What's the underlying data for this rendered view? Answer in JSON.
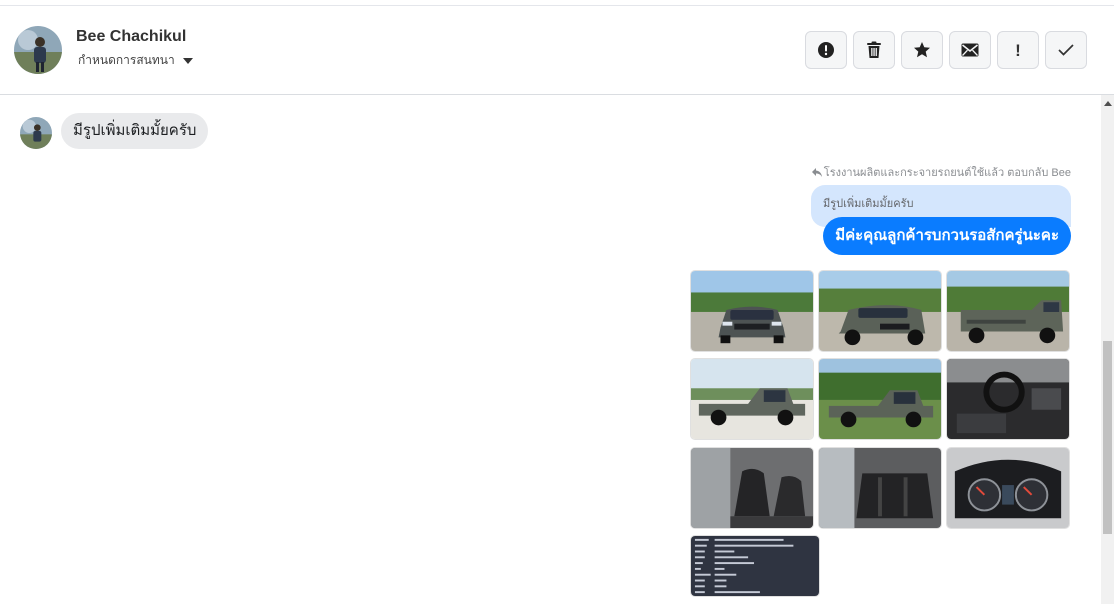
{
  "header": {
    "contact_name": "Bee Chachikul",
    "assign_label": "กำหนดการสนทนา"
  },
  "actions": [
    {
      "name": "alert-circle-icon",
      "label": ""
    },
    {
      "name": "trash-icon",
      "label": ""
    },
    {
      "name": "star-icon",
      "label": ""
    },
    {
      "name": "mail-icon",
      "label": ""
    },
    {
      "name": "exclamation-icon",
      "label": "!"
    },
    {
      "name": "check-icon",
      "label": ""
    }
  ],
  "messages": {
    "incoming_text": "มีรูปเพิ่มเติมมั้ยครับ",
    "reply_note": "โรงงานผลิตและกระจายรถยนต์ใช้แล้ว ตอบกลับ Bee",
    "quoted_text": "มีรูปเพิ่มเติมมั้ยครับ",
    "outgoing_text": "มีค่ะคุณลูกค้ารบกวนรอสักครู่นะคะ"
  },
  "photos": [
    {
      "name": "car-front-photo",
      "scene": "front"
    },
    {
      "name": "car-front-angle-photo",
      "scene": "front-angle"
    },
    {
      "name": "car-rear-photo",
      "scene": "rear"
    },
    {
      "name": "car-side-photo",
      "scene": "side"
    },
    {
      "name": "car-side-grass-photo",
      "scene": "side-grass"
    },
    {
      "name": "dashboard-photo",
      "scene": "dashboard"
    },
    {
      "name": "front-seats-photo",
      "scene": "seats"
    },
    {
      "name": "rear-seats-photo",
      "scene": "rear-seats"
    },
    {
      "name": "gauge-cluster-photo",
      "scene": "gauges"
    },
    {
      "name": "registration-document-photo",
      "scene": "document"
    }
  ],
  "colors": {
    "outgoing_bubble": "#0a7cff",
    "quoted_bubble": "#d4e6fd",
    "incoming_bubble": "#e9eaec"
  }
}
